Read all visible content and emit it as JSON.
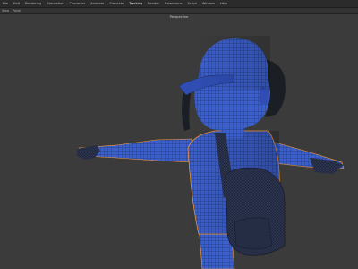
{
  "menubar": {
    "items": [
      "File",
      "Edit",
      "Rendering",
      "Simulation",
      "Character",
      "Animate",
      "Simulate",
      "Tracking",
      "Render",
      "Extensions",
      "Script",
      "Window",
      "Help"
    ],
    "active_index": 7
  },
  "toolbar": {
    "items": [
      "View",
      "Panel"
    ]
  },
  "viewport": {
    "title": "Perspective"
  },
  "colors": {
    "mesh_blue": "#3a5fd0",
    "wire": "#1b2a55",
    "selection_outline": "#ff9a2a",
    "background": "#3b3b3b"
  }
}
